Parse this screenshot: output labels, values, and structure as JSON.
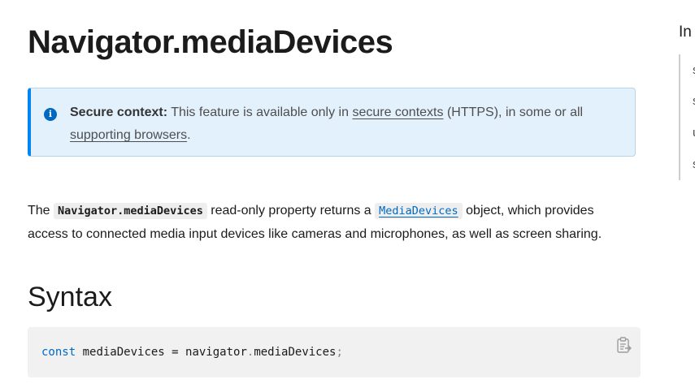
{
  "article": {
    "title": "Navigator.mediaDevices",
    "note": {
      "label": "Secure context:",
      "text_before": " This feature is available only in ",
      "link1": "secure contexts",
      "text_middle": " (HTTPS), in some or all ",
      "link2": "supporting browsers",
      "text_after": "."
    },
    "description": {
      "part1": "The ",
      "code1": "Navigator.mediaDevices",
      "part2": " read-only property returns a ",
      "code_link": "MediaDevices",
      "part3": " object, which provides access to connected media input devices like cameras and microphones, as well as screen sharing."
    },
    "syntax_heading": "Syntax",
    "code_sample": {
      "keyword": "const",
      "rest": " mediaDevices = navigator",
      "dot": ".",
      "property": "mediaDevices",
      "semicolon": ";"
    }
  },
  "toc": {
    "title": "In",
    "items": [
      "s",
      "s",
      "u",
      "s"
    ]
  },
  "colors": {
    "accent": "#0085f2",
    "link": "#0069c2",
    "note_background": "#e3f1fd"
  },
  "icons": {
    "note": "info-icon",
    "copy": "clipboard-copy-icon"
  }
}
